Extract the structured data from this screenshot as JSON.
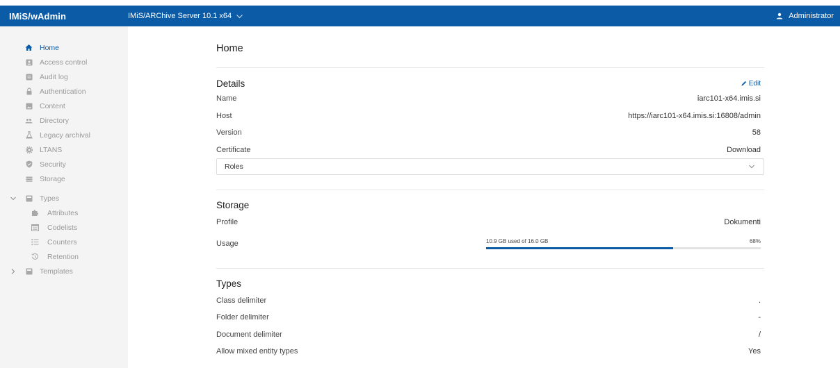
{
  "header": {
    "brand": "IMiS/wAdmin",
    "server": "IMiS/ARChive Server 10.1 x64",
    "user": "Administrator",
    "bar_color": "#0c5ba6"
  },
  "sidebar": {
    "items": [
      {
        "label": "Home",
        "icon": "home-icon",
        "active": true
      },
      {
        "label": "Access control",
        "icon": "contact-card-icon"
      },
      {
        "label": "Audit log",
        "icon": "list-box-icon"
      },
      {
        "label": "Authentication",
        "icon": "lock-icon"
      },
      {
        "label": "Content",
        "icon": "image-box-icon"
      },
      {
        "label": "Directory",
        "icon": "people-icon"
      },
      {
        "label": "Legacy archival",
        "icon": "flask-icon"
      },
      {
        "label": "LTANS",
        "icon": "gear-icon"
      },
      {
        "label": "Security",
        "icon": "shield-icon"
      },
      {
        "label": "Storage",
        "icon": "storage-icon"
      }
    ],
    "types": {
      "label": "Types",
      "children": [
        "Attributes",
        "Codelists",
        "Counters",
        "Retention"
      ]
    },
    "templates": {
      "label": "Templates"
    }
  },
  "main": {
    "title": "Home",
    "details": {
      "title": "Details",
      "edit": "Edit",
      "rows": [
        {
          "label": "Name",
          "value": "iarc101-x64.imis.si"
        },
        {
          "label": "Host",
          "value": "https://iarc101-x64.imis.si:16808/admin"
        },
        {
          "label": "Version",
          "value": "58"
        }
      ],
      "certificate_label": "Certificate",
      "certificate_action": "Download",
      "roles": "Roles"
    },
    "storage": {
      "title": "Storage",
      "profile_label": "Profile",
      "profile_value": "Dokumenti",
      "usage_label": "Usage",
      "usage_text": "10.9 GB used of 16.0 GB",
      "usage_percent_text": "68%",
      "usage_fraction": 0.68
    },
    "types": {
      "title": "Types",
      "rows": [
        {
          "label": "Class delimiter",
          "value": "."
        },
        {
          "label": "Folder delimiter",
          "value": "-"
        },
        {
          "label": "Document delimiter",
          "value": "/"
        },
        {
          "label": "Allow mixed entity types",
          "value": "Yes"
        }
      ]
    }
  }
}
